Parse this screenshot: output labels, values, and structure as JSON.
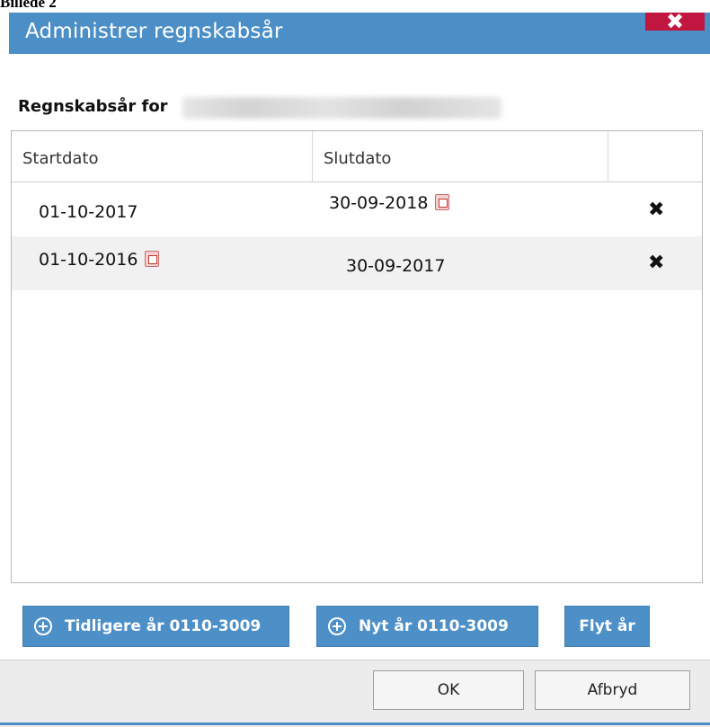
{
  "page_caption": "Billede 2",
  "dialog": {
    "title": "Administrer regnskabsår",
    "close_glyph": "✖",
    "header_label": "Regnskabsår for"
  },
  "grid": {
    "columns": [
      "Startdato",
      "Slutdato",
      ""
    ],
    "rows": [
      {
        "start": "01-10-2017",
        "end": "30-09-2018",
        "editing": "end"
      },
      {
        "start": "01-10-2016",
        "end": "30-09-2017",
        "editing": "start"
      }
    ],
    "delete_glyph": "✖"
  },
  "actions": {
    "earlier_year": "Tidligere år 0110-3009",
    "new_year": "Nyt år 0110-3009",
    "move_year": "Flyt år"
  },
  "footer": {
    "ok": "OK",
    "cancel": "Afbryd"
  },
  "colors": {
    "titlebar": "#4b8fc6",
    "close_button": "#c1163f",
    "action_button": "#4d8fc7"
  },
  "icons": {
    "calendar": "calendar-icon",
    "delete": "delete-icon",
    "plus": "plus-circle-icon"
  }
}
